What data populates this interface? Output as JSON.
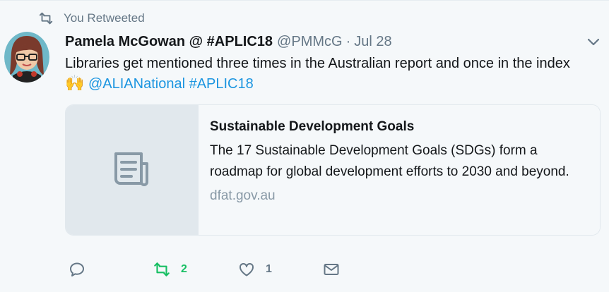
{
  "context": {
    "label": "You Retweeted"
  },
  "author": {
    "name": "Pamela McGowan @ #APLIC18",
    "handle": "@PMMcG",
    "separator": "·",
    "time": "Jul 28"
  },
  "tweet": {
    "text": "Libraries get mentioned three times in the Australian report and once in the index",
    "emoji": "🙌",
    "mention": "@ALIANational",
    "hashtag": "#APLIC18"
  },
  "card": {
    "title": "Sustainable Development Goals",
    "description": "The 17 Sustainable Development Goals (SDGs) form a roadmap for global development efforts to 2030 and beyond.",
    "domain": "dfat.gov.au",
    "icon": "document-icon"
  },
  "actions": {
    "reply": {
      "icon": "reply-icon",
      "count": ""
    },
    "retweet": {
      "icon": "retweet-icon",
      "count": "2"
    },
    "like": {
      "icon": "heart-icon",
      "count": "1"
    },
    "dm": {
      "icon": "envelope-icon"
    }
  },
  "colors": {
    "background": "#f5f8fa",
    "link": "#1b95e0",
    "secondary_text": "#657786",
    "retweet_active": "#17bf63",
    "card_media": "#e1e8ed"
  }
}
